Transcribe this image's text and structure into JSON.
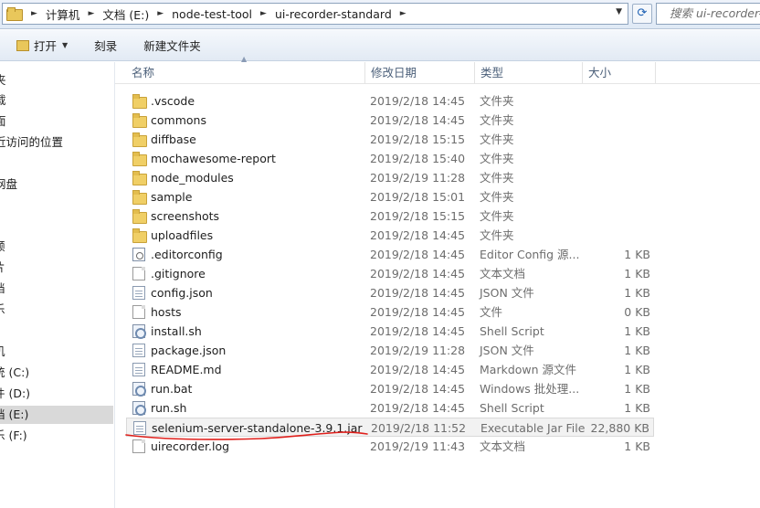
{
  "address_bar": {
    "breadcrumbs": [
      "计算机",
      "文档 (E:)",
      "node-test-tool",
      "ui-recorder-standard"
    ],
    "search_placeholder": "搜索 ui-recorder-standard"
  },
  "toolbar": {
    "open_label": "打开",
    "burn_label": "刻录",
    "new_folder_label": "新建文件夹"
  },
  "navigation": {
    "items": [
      {
        "label": "夹",
        "selected": false
      },
      {
        "label": "载",
        "selected": false
      },
      {
        "label": "面",
        "selected": false
      },
      {
        "label": "近访问的位置",
        "selected": false
      },
      {
        "label": "网盘",
        "selected": false
      },
      {
        "label": "频",
        "selected": false
      },
      {
        "label": "片",
        "selected": false
      },
      {
        "label": "档",
        "selected": false
      },
      {
        "label": "乐",
        "selected": false
      },
      {
        "label": "机",
        "selected": false
      },
      {
        "label": "统 (C:)",
        "selected": false
      },
      {
        "label": "件 (D:)",
        "selected": false
      },
      {
        "label": "档 (E:)",
        "selected": true
      },
      {
        "label": "乐 (F:)",
        "selected": false
      }
    ]
  },
  "columns": {
    "name": "名称",
    "modified": "修改日期",
    "type": "类型",
    "size": "大小"
  },
  "files": [
    {
      "name": ".vscode",
      "modified": "2019/2/18 14:45",
      "type": "文件夹",
      "size": "",
      "icon": "folder-icon"
    },
    {
      "name": "commons",
      "modified": "2019/2/18 14:45",
      "type": "文件夹",
      "size": "",
      "icon": "folder-icon"
    },
    {
      "name": "diffbase",
      "modified": "2019/2/18 15:15",
      "type": "文件夹",
      "size": "",
      "icon": "folder-icon"
    },
    {
      "name": "mochawesome-report",
      "modified": "2019/2/18 15:40",
      "type": "文件夹",
      "size": "",
      "icon": "folder-icon"
    },
    {
      "name": "node_modules",
      "modified": "2019/2/19 11:28",
      "type": "文件夹",
      "size": "",
      "icon": "folder-icon"
    },
    {
      "name": "sample",
      "modified": "2019/2/18 15:01",
      "type": "文件夹",
      "size": "",
      "icon": "folder-icon"
    },
    {
      "name": "screenshots",
      "modified": "2019/2/18 15:15",
      "type": "文件夹",
      "size": "",
      "icon": "folder-icon"
    },
    {
      "name": "uploadfiles",
      "modified": "2019/2/18 14:45",
      "type": "文件夹",
      "size": "",
      "icon": "folder-icon"
    },
    {
      "name": ".editorconfig",
      "modified": "2019/2/18 14:45",
      "type": "Editor Config 源...",
      "size": "1 KB",
      "icon": "config-file-icon"
    },
    {
      "name": ".gitignore",
      "modified": "2019/2/18 14:45",
      "type": "文本文档",
      "size": "1 KB",
      "icon": "text-file-icon"
    },
    {
      "name": "config.json",
      "modified": "2019/2/18 14:45",
      "type": "JSON 文件",
      "size": "1 KB",
      "icon": "json-file-icon"
    },
    {
      "name": "hosts",
      "modified": "2019/2/18 14:45",
      "type": "文件",
      "size": "0 KB",
      "icon": "blank-file-icon"
    },
    {
      "name": "install.sh",
      "modified": "2019/2/18 14:45",
      "type": "Shell Script",
      "size": "1 KB",
      "icon": "script-file-icon"
    },
    {
      "name": "package.json",
      "modified": "2019/2/19 11:28",
      "type": "JSON 文件",
      "size": "1 KB",
      "icon": "json-file-icon"
    },
    {
      "name": "README.md",
      "modified": "2019/2/18 14:45",
      "type": "Markdown 源文件",
      "size": "1 KB",
      "icon": "markdown-file-icon"
    },
    {
      "name": "run.bat",
      "modified": "2019/2/18 14:45",
      "type": "Windows 批处理...",
      "size": "1 KB",
      "icon": "script-file-icon"
    },
    {
      "name": "run.sh",
      "modified": "2019/2/18 14:45",
      "type": "Shell Script",
      "size": "1 KB",
      "icon": "script-file-icon"
    },
    {
      "name": "selenium-server-standalone-3.9.1.jar",
      "modified": "2019/2/18 11:52",
      "type": "Executable Jar File",
      "size": "22,880 KB",
      "icon": "jar-file-icon",
      "selected": true,
      "annotated": true
    },
    {
      "name": "uirecorder.log",
      "modified": "2019/2/19 11:43",
      "type": "文本文档",
      "size": "1 KB",
      "icon": "text-file-icon"
    }
  ],
  "colors": {
    "annotation_underline": "#e0201c",
    "selection_bg": "#f2f2f2",
    "header_text": "#4c607a"
  }
}
